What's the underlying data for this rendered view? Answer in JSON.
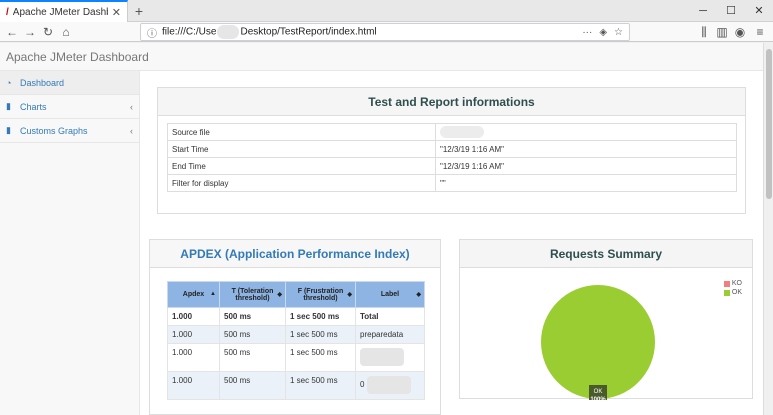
{
  "browser": {
    "tab_title": "Apache JMeter Dashboard",
    "url_prefix": "file:///C:/Use",
    "url_suffix": "Desktop/TestReport/index.html",
    "more": "···"
  },
  "app": {
    "brand": "Apache JMeter Dashboard"
  },
  "sidebar": {
    "items": [
      {
        "label": "Dashboard",
        "icon": "dashboard-icon"
      },
      {
        "label": "Charts",
        "icon": "bar-chart-icon"
      },
      {
        "label": "Customs Graphs",
        "icon": "bar-chart-icon"
      }
    ]
  },
  "info": {
    "title": "Test and Report informations",
    "rows": [
      {
        "key": "Source file",
        "value": ""
      },
      {
        "key": "Start Time",
        "value": "\"12/3/19 1:16 AM\""
      },
      {
        "key": "End Time",
        "value": "\"12/3/19 1:16 AM\""
      },
      {
        "key": "Filter for display",
        "value": "\"\""
      }
    ]
  },
  "apdex": {
    "title": "APDEX (Application Performance Index)",
    "headers": [
      "Apdex",
      "T (Toleration threshold)",
      "F (Frustration threshold)",
      "Label"
    ],
    "rows": [
      [
        "1.000",
        "500 ms",
        "1 sec 500 ms",
        "Total"
      ],
      [
        "1.000",
        "500 ms",
        "1 sec 500 ms",
        "preparedata"
      ],
      [
        "1.000",
        "500 ms",
        "1 sec 500 ms",
        ""
      ],
      [
        "1.000",
        "500 ms",
        "1 sec 500 ms",
        "0"
      ]
    ]
  },
  "summary": {
    "title": "Requests Summary",
    "legend": [
      {
        "label": "KO",
        "color": "#f08080"
      },
      {
        "label": "OK",
        "color": "#9acd32"
      }
    ],
    "slice_label": "OK",
    "slice_pct": "100%"
  },
  "chart_data": {
    "type": "pie",
    "title": "Requests Summary",
    "categories": [
      "KO",
      "OK"
    ],
    "values": [
      0,
      100
    ],
    "colors": [
      "#f08080",
      "#9acd32"
    ],
    "legend": "top-right"
  }
}
